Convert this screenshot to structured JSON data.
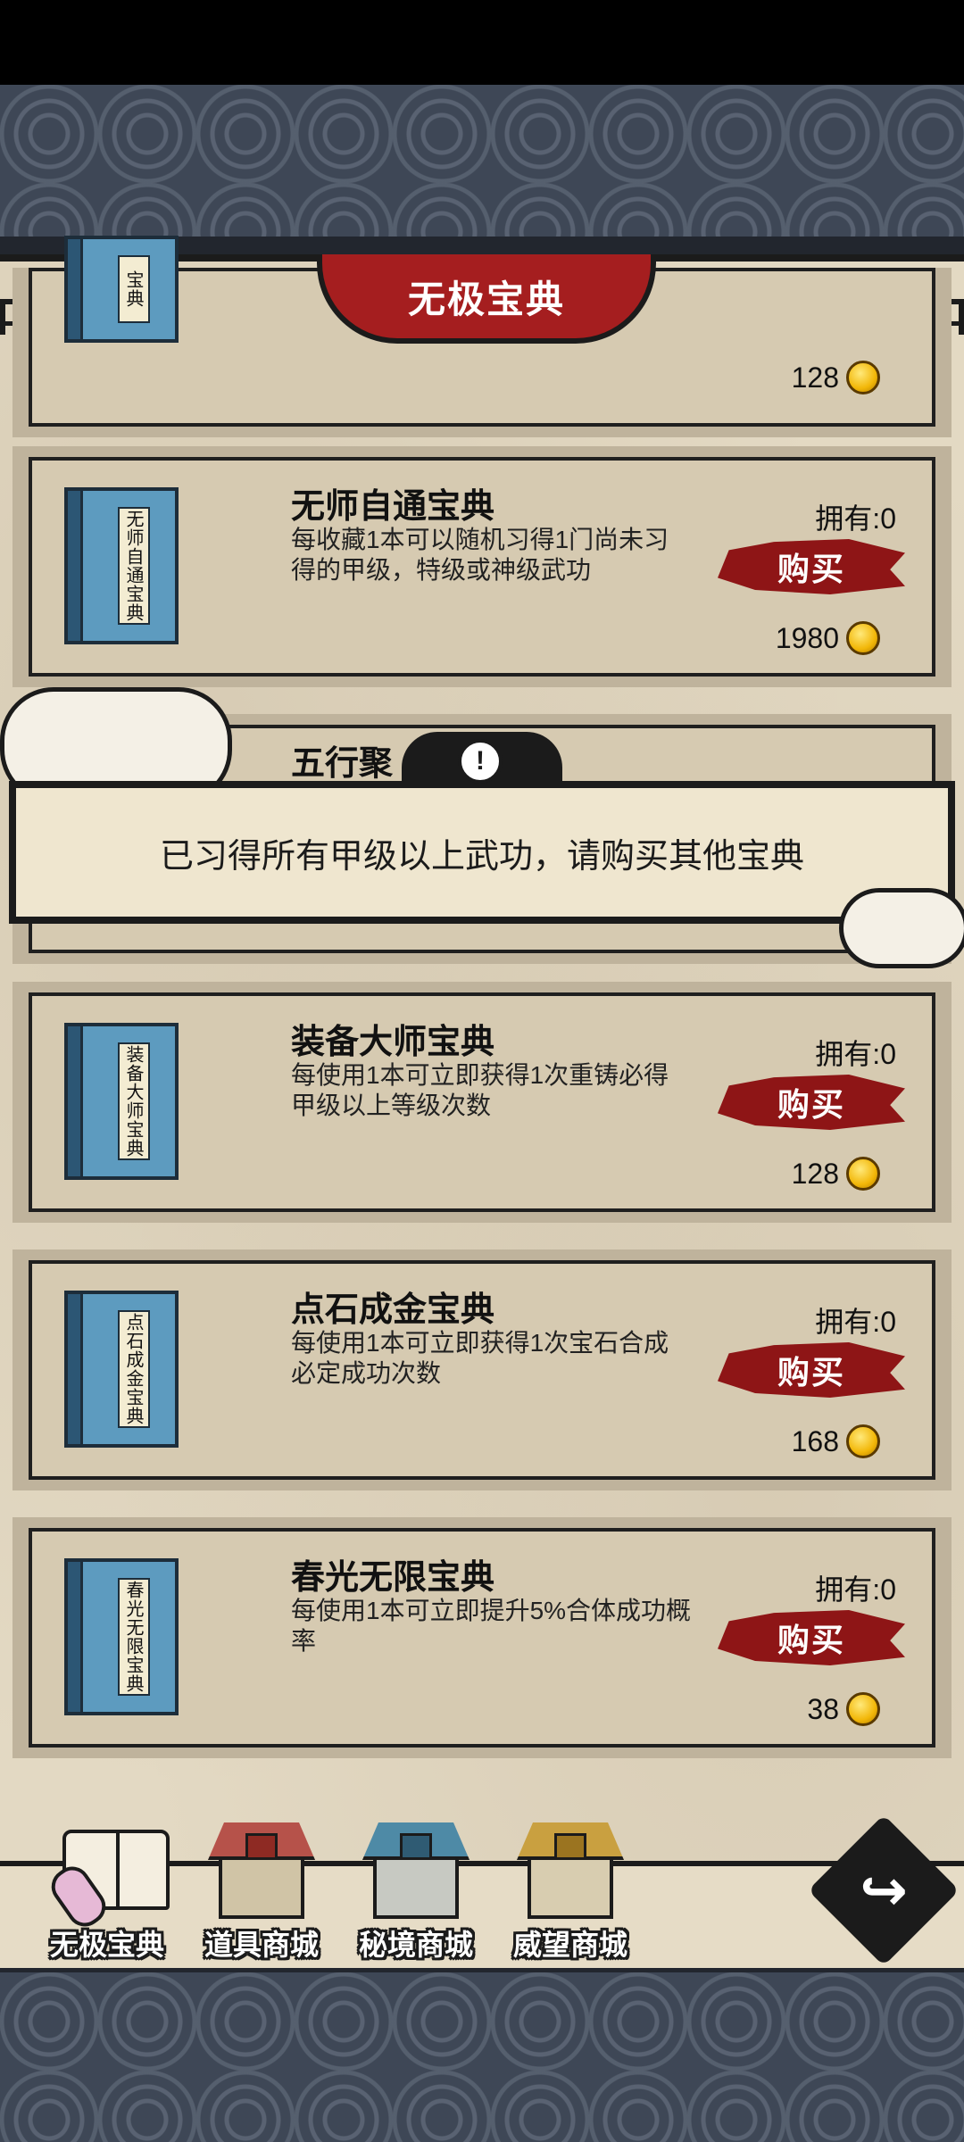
{
  "header": {
    "title": "无极宝典"
  },
  "items": [
    {
      "name": "",
      "book_label": "宝典",
      "description": "",
      "owned": "",
      "buy_label": "",
      "price": "128"
    },
    {
      "name": "无师自通宝典",
      "book_label": "无师自通宝典",
      "description": "每收藏1本可以随机习得1门尚未习得的甲级，特级或神级武功",
      "owned": "拥有:0",
      "buy_label": "购买",
      "price": "1980"
    },
    {
      "name": "五行聚",
      "book_label": "",
      "description": "",
      "owned": "",
      "buy_label": "",
      "price": ""
    },
    {
      "name": "装备大师宝典",
      "book_label": "装备大师宝典",
      "description": "每使用1本可立即获得1次重铸必得甲级以上等级次数",
      "owned": "拥有:0",
      "buy_label": "购买",
      "price": "128"
    },
    {
      "name": "点石成金宝典",
      "book_label": "点石成金宝典",
      "description": "每使用1本可立即获得1次宝石合成必定成功次数",
      "owned": "拥有:0",
      "buy_label": "购买",
      "price": "168"
    },
    {
      "name": "春光无限宝典",
      "book_label": "春光无限宝典",
      "description": "每使用1本可立即提升5%合体成功概率",
      "owned": "拥有:0",
      "buy_label": "购买",
      "price": "38"
    }
  ],
  "toast": {
    "icon": "alert-icon",
    "glyph": "!",
    "message": "已习得所有甲级以上武功，请购买其他宝典"
  },
  "nav": {
    "tabs": [
      {
        "label": "无极宝典",
        "icon": "open-book-icon",
        "active": true
      },
      {
        "label": "道具商城",
        "icon": "shop-red-icon",
        "active": false
      },
      {
        "label": "秘境商城",
        "icon": "shop-blue-icon",
        "active": false
      },
      {
        "label": "威望商城",
        "icon": "shop-gold-icon",
        "active": false
      }
    ],
    "back_icon": "return-arrow-icon",
    "back_glyph": "↪"
  },
  "colors": {
    "accent_red": "#a51e1f",
    "panel_paper": "#e3d9c3",
    "book_blue": "#5d9bbf",
    "coin_gold": "#f2b708"
  }
}
